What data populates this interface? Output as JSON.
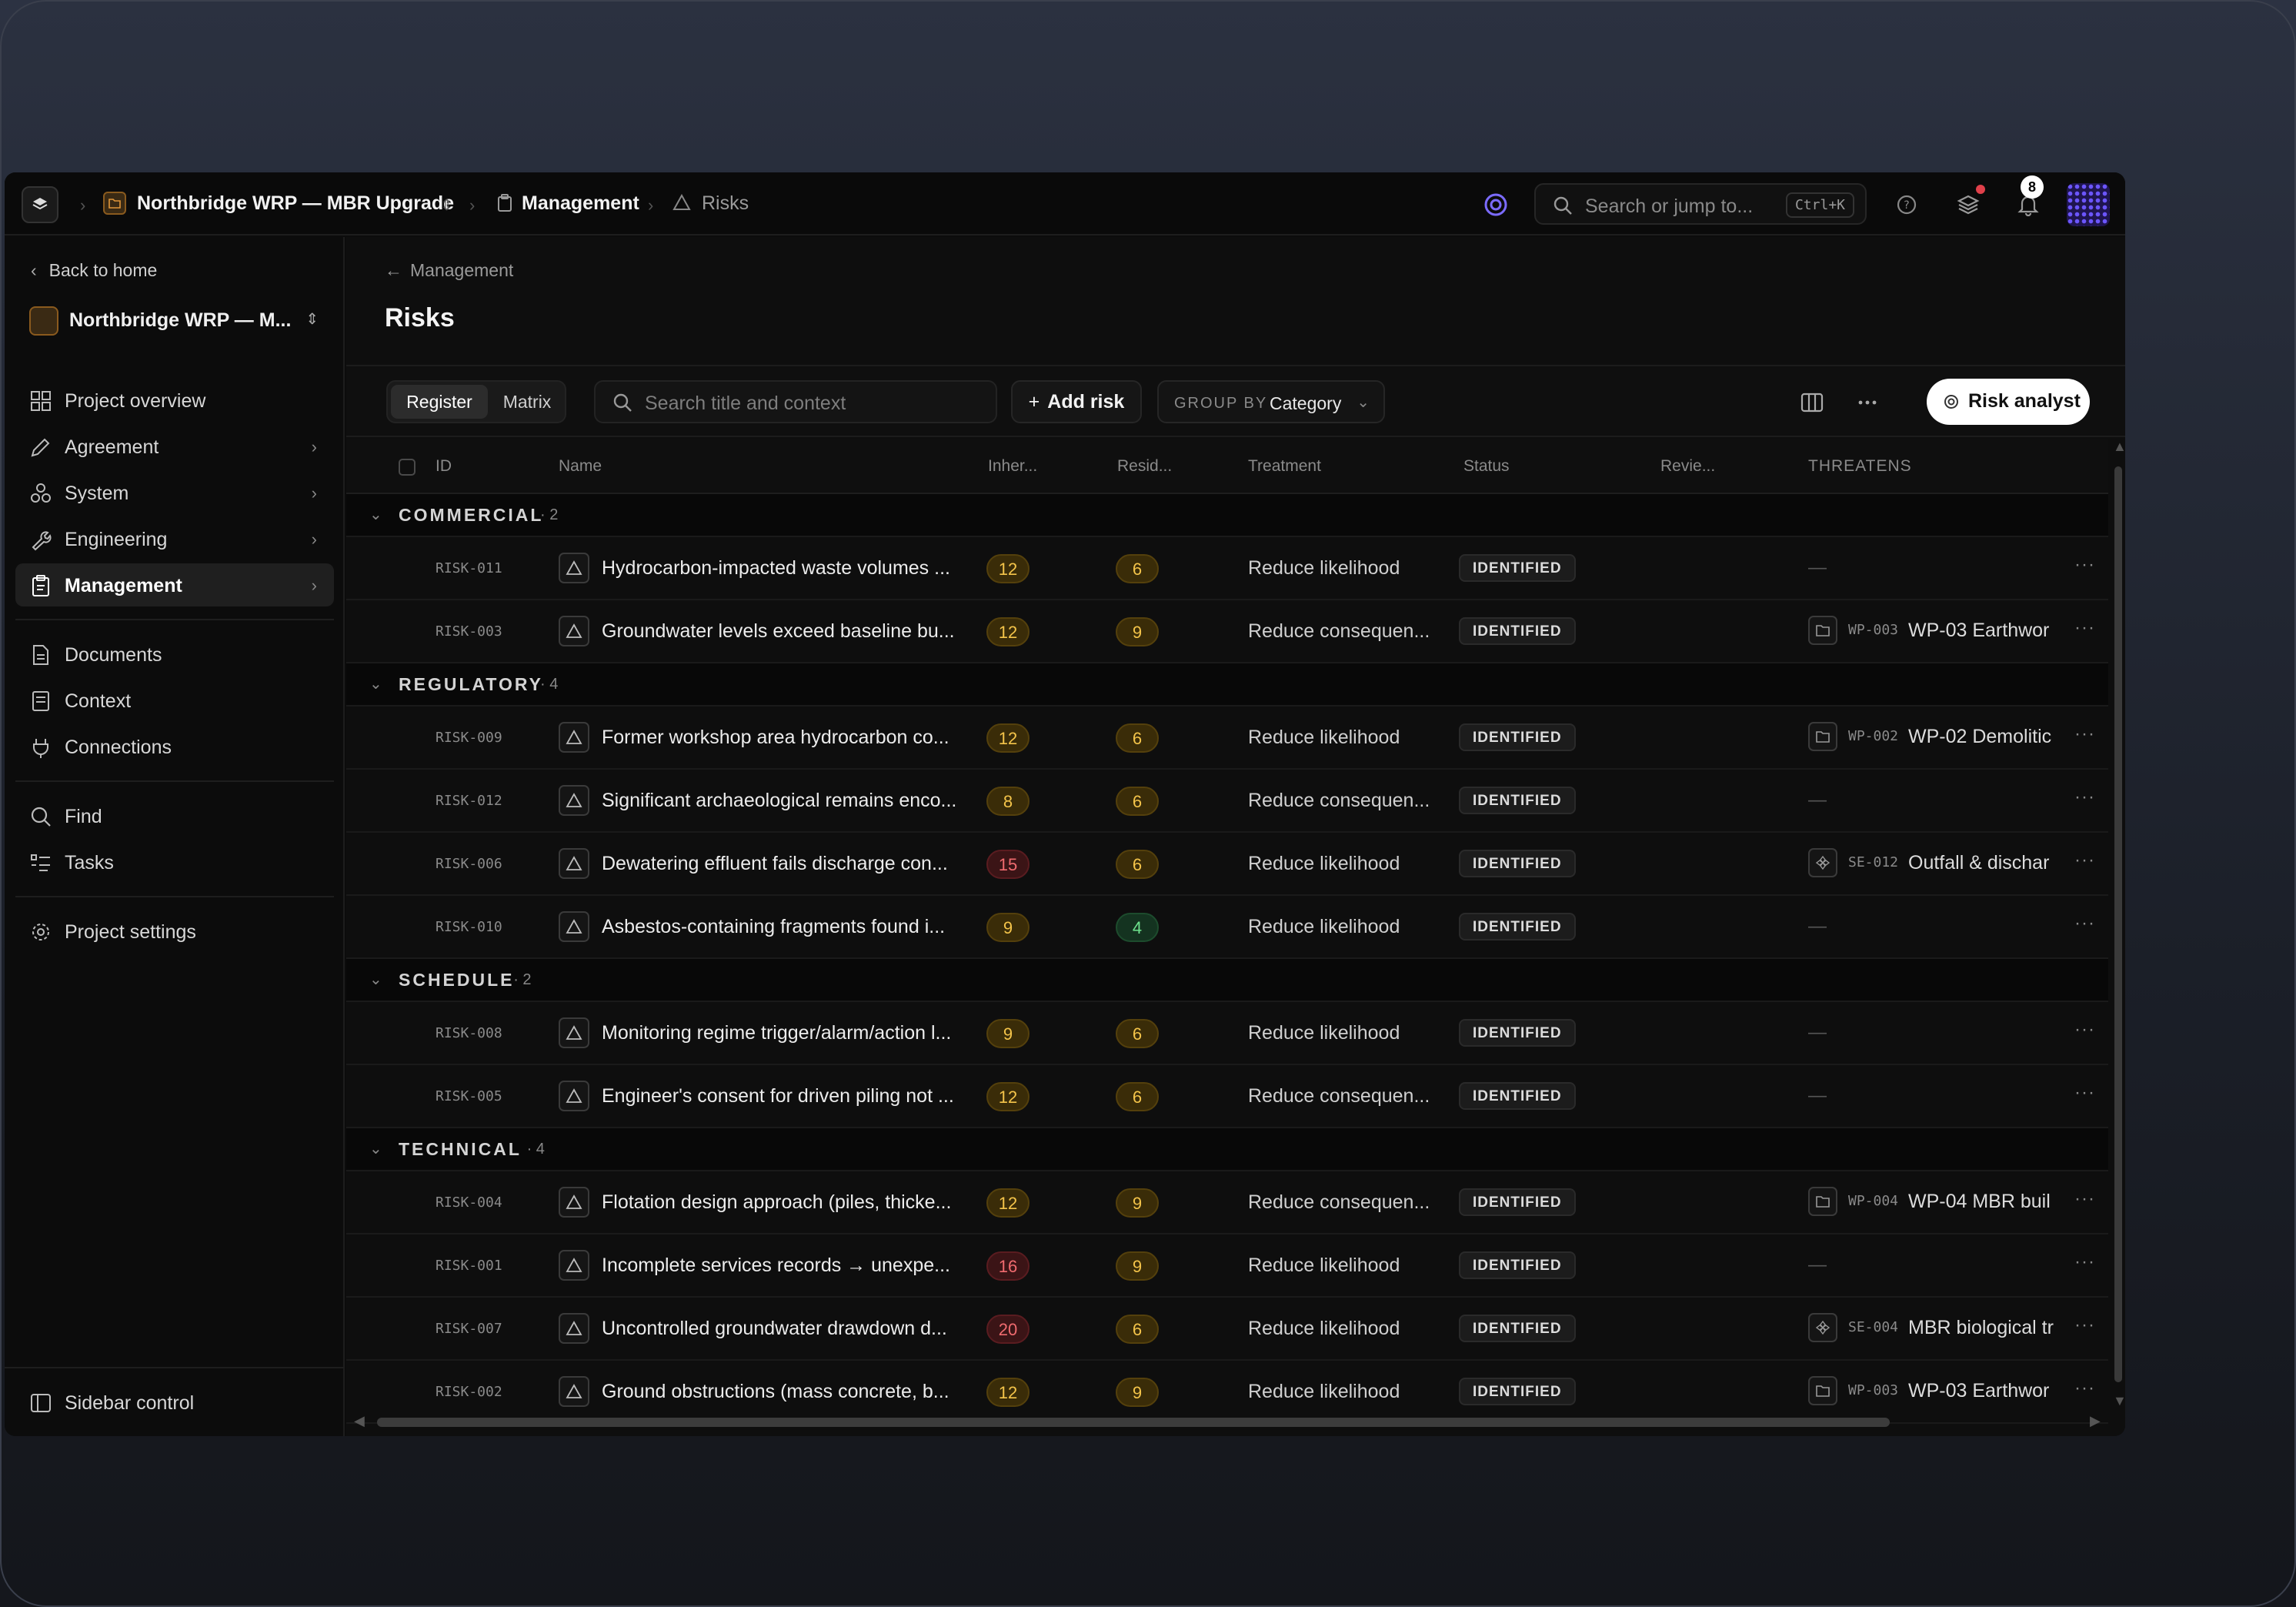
{
  "topbar": {
    "project": "Northbridge WRP — MBR Upgrade",
    "section": "Management",
    "page": "Risks",
    "search_placeholder": "Search or jump to...",
    "shortcut": "Ctrl+K",
    "notifications_count": "8"
  },
  "sidebar": {
    "back": "Back to home",
    "project_name": "Northbridge WRP — M...",
    "items": [
      {
        "label": "Project overview"
      },
      {
        "label": "Agreement"
      },
      {
        "label": "System"
      },
      {
        "label": "Engineering"
      },
      {
        "label": "Management"
      },
      {
        "label": "Documents"
      },
      {
        "label": "Context"
      },
      {
        "label": "Connections"
      },
      {
        "label": "Find"
      },
      {
        "label": "Tasks"
      },
      {
        "label": "Project settings"
      }
    ],
    "footer": "Sidebar control"
  },
  "main": {
    "back_link": "Management",
    "title": "Risks",
    "view_tabs": [
      "Register",
      "Matrix"
    ],
    "search_placeholder": "Search title and context",
    "add_label": "Add risk",
    "group_by_key": "GROUP BY",
    "group_by_value": "Category",
    "analyst_label": "Risk analyst"
  },
  "table": {
    "headers": [
      "ID",
      "Name",
      "Inher...",
      "Resid...",
      "Treatment",
      "Status",
      "Revie...",
      "THREATENS"
    ],
    "groups": [
      {
        "name": "COMMERCIAL",
        "count": "· 2",
        "rows": [
          {
            "id": "RISK-011",
            "name": "Hydrocarbon-impacted waste volumes ...",
            "inherent": "12",
            "residual": "6",
            "treatment": "Reduce likelihood",
            "status": "IDENTIFIED",
            "threat_id": "",
            "threat_name": ""
          },
          {
            "id": "RISK-003",
            "name": "Groundwater levels exceed baseline bu...",
            "inherent": "12",
            "residual": "9",
            "treatment": "Reduce consequen...",
            "status": "IDENTIFIED",
            "threat_id": "WP-003",
            "threat_name": "WP-03 Earthwor"
          }
        ]
      },
      {
        "name": "REGULATORY",
        "count": "· 4",
        "rows": [
          {
            "id": "RISK-009",
            "name": "Former workshop area hydrocarbon co...",
            "inherent": "12",
            "residual": "6",
            "treatment": "Reduce likelihood",
            "status": "IDENTIFIED",
            "threat_id": "WP-002",
            "threat_name": "WP-02 Demolitic"
          },
          {
            "id": "RISK-012",
            "name": "Significant archaeological remains enco...",
            "inherent": "8",
            "residual": "6",
            "treatment": "Reduce consequen...",
            "status": "IDENTIFIED",
            "threat_id": "",
            "threat_name": ""
          },
          {
            "id": "RISK-006",
            "name": "Dewatering effluent fails discharge con...",
            "inherent": "15",
            "residual": "6",
            "treatment": "Reduce likelihood",
            "status": "IDENTIFIED",
            "threat_id": "SE-012",
            "threat_name": "Outfall & dischar"
          },
          {
            "id": "RISK-010",
            "name": "Asbestos-containing fragments found i...",
            "inherent": "9",
            "residual": "4",
            "treatment": "Reduce likelihood",
            "status": "IDENTIFIED",
            "threat_id": "",
            "threat_name": ""
          }
        ]
      },
      {
        "name": "SCHEDULE",
        "count": "· 2",
        "rows": [
          {
            "id": "RISK-008",
            "name": "Monitoring regime trigger/alarm/action l...",
            "inherent": "9",
            "residual": "6",
            "treatment": "Reduce likelihood",
            "status": "IDENTIFIED",
            "threat_id": "",
            "threat_name": ""
          },
          {
            "id": "RISK-005",
            "name": "Engineer's consent for driven piling not ...",
            "inherent": "12",
            "residual": "6",
            "treatment": "Reduce consequen...",
            "status": "IDENTIFIED",
            "threat_id": "",
            "threat_name": ""
          }
        ]
      },
      {
        "name": "TECHNICAL",
        "count": "· 4",
        "rows": [
          {
            "id": "RISK-004",
            "name": "Flotation design approach (piles, thicke...",
            "inherent": "12",
            "residual": "9",
            "treatment": "Reduce consequen...",
            "status": "IDENTIFIED",
            "threat_id": "WP-004",
            "threat_name": "WP-04 MBR buil"
          },
          {
            "id": "RISK-001",
            "name": "Incomplete services records → unexpe...",
            "inherent": "16",
            "residual": "9",
            "treatment": "Reduce likelihood",
            "status": "IDENTIFIED",
            "threat_id": "",
            "threat_name": ""
          },
          {
            "id": "RISK-007",
            "name": "Uncontrolled groundwater drawdown d...",
            "inherent": "20",
            "residual": "6",
            "treatment": "Reduce likelihood",
            "status": "IDENTIFIED",
            "threat_id": "SE-004",
            "threat_name": "MBR biological tr"
          },
          {
            "id": "RISK-002",
            "name": "Ground obstructions (mass concrete, b...",
            "inherent": "12",
            "residual": "9",
            "treatment": "Reduce likelihood",
            "status": "IDENTIFIED",
            "threat_id": "WP-003",
            "threat_name": "WP-03 Earthwor"
          }
        ]
      }
    ]
  },
  "colors": {
    "score_high": "#f06b6f",
    "score_mid": "#f4c44a",
    "score_low": "#6ee38e",
    "accent": "#6b55ff"
  }
}
